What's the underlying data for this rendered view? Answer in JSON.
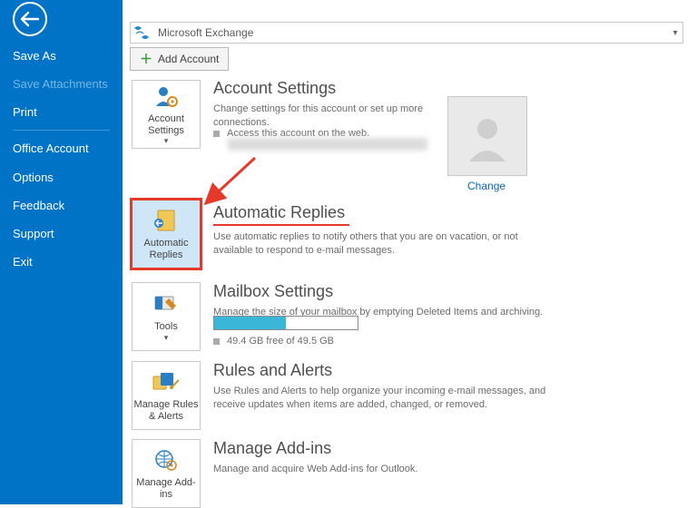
{
  "sidebar": {
    "items": [
      {
        "label": "Save As"
      },
      {
        "label": "Save Attachments"
      },
      {
        "label": "Print"
      },
      {
        "label": "Office Account"
      },
      {
        "label": "Options"
      },
      {
        "label": "Feedback"
      },
      {
        "label": "Support"
      },
      {
        "label": "Exit"
      }
    ]
  },
  "account_selector": {
    "label": "Microsoft Exchange"
  },
  "add_account_label": "Add Account",
  "avatar": {
    "change_label": "Change"
  },
  "sections": {
    "account": {
      "tile_label": "Account Settings",
      "title": "Account Settings",
      "desc": "Change settings for this account or set up more connections.",
      "link": "Access this account on the web."
    },
    "autoreply": {
      "tile_label": "Automatic Replies",
      "title": "Automatic Replies",
      "desc": "Use automatic replies to notify others that you are on vacation, or not available to respond to e-mail messages."
    },
    "mailbox": {
      "tile_label": "Tools",
      "title": "Mailbox Settings",
      "desc": "Manage the size of your mailbox by emptying Deleted Items and archiving.",
      "free_text": "49.4 GB free of 49.5 GB",
      "percent_used": 0.5
    },
    "rules": {
      "tile_label": "Manage Rules & Alerts",
      "title": "Rules and Alerts",
      "desc": "Use Rules and Alerts to help organize your incoming e-mail messages, and receive updates when items are added, changed, or removed."
    },
    "addins": {
      "tile_label": "Manage Add-ins",
      "title": "Manage Add-ins",
      "desc": "Manage and acquire Web Add-ins for Outlook."
    }
  }
}
